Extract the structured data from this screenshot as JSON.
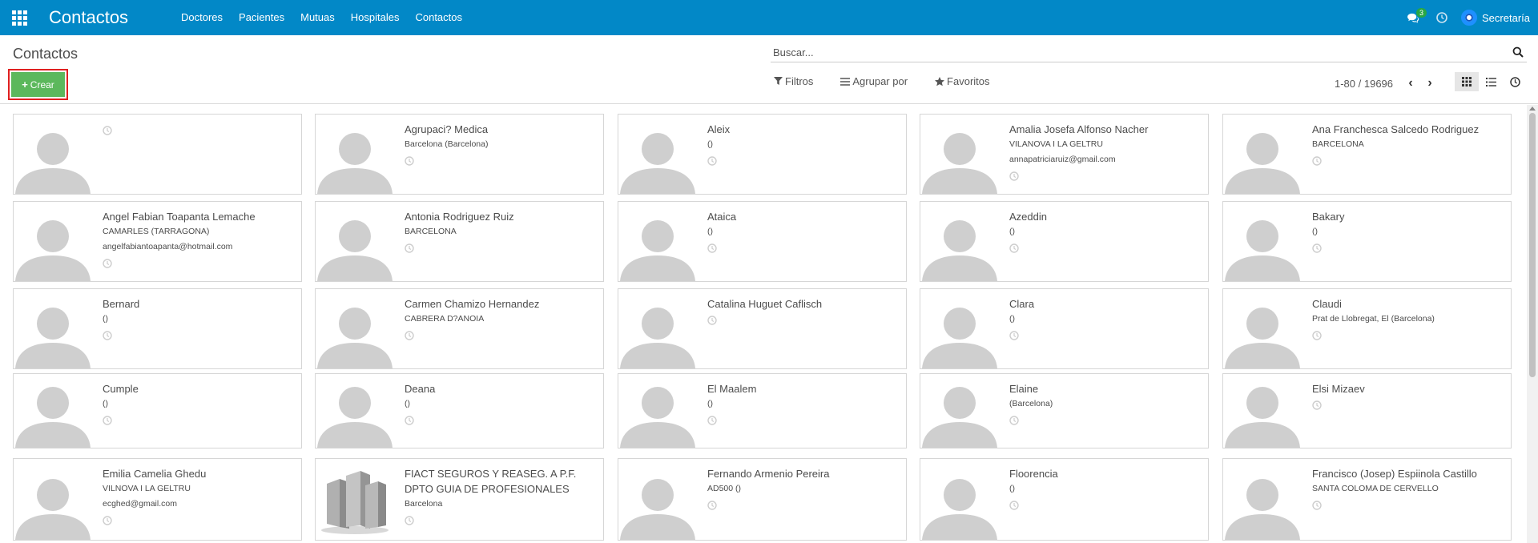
{
  "navbar": {
    "app_title": "Contactos",
    "menu": [
      "Doctores",
      "Pacientes",
      "Mutuas",
      "Hospitales",
      "Contactos"
    ],
    "messages_count": "3",
    "user_name": "Secretaría"
  },
  "control_panel": {
    "title": "Contactos",
    "create_label": "Crear",
    "search_placeholder": "Buscar...",
    "filters_label": "Filtros",
    "group_by_label": "Agrupar por",
    "favorites_label": "Favoritos",
    "pager": "1-80 / 19696"
  },
  "cards": [
    {
      "name": "",
      "lines": [],
      "type": "person"
    },
    {
      "name": "Agrupaci? Medica",
      "lines": [
        "Barcelona (Barcelona)"
      ],
      "type": "person"
    },
    {
      "name": "Aleix",
      "lines": [
        "()"
      ],
      "type": "person"
    },
    {
      "name": "Amalia Josefa Alfonso Nacher",
      "lines": [
        "VILANOVA I LA GELTRU",
        "annapatriciaruiz@gmail.com"
      ],
      "type": "person"
    },
    {
      "name": "Ana Franchesca Salcedo Rodriguez",
      "lines": [
        "BARCELONA"
      ],
      "type": "person"
    },
    {
      "name": "Angel Fabian Toapanta Lemache",
      "lines": [
        "CAMARLES (TARRAGONA)",
        "angelfabiantoapanta@hotmail.com"
      ],
      "type": "person"
    },
    {
      "name": "Antonia Rodriguez Ruiz",
      "lines": [
        "BARCELONA"
      ],
      "type": "person"
    },
    {
      "name": "Ataica",
      "lines": [
        "()"
      ],
      "type": "person"
    },
    {
      "name": "Azeddin",
      "lines": [
        "()"
      ],
      "type": "person"
    },
    {
      "name": "Bakary",
      "lines": [
        "()"
      ],
      "type": "person"
    },
    {
      "name": "Bernard",
      "lines": [
        "()"
      ],
      "type": "person"
    },
    {
      "name": "Carmen Chamizo Hernandez",
      "lines": [
        "CABRERA D?ANOIA"
      ],
      "type": "person"
    },
    {
      "name": "Catalina Huguet Caflisch",
      "lines": [],
      "type": "person"
    },
    {
      "name": "Clara",
      "lines": [
        "()"
      ],
      "type": "person"
    },
    {
      "name": "Claudi",
      "lines": [
        "Prat de Llobregat, El (Barcelona)"
      ],
      "type": "person"
    },
    {
      "name": "Cumple",
      "lines": [
        "()"
      ],
      "type": "person"
    },
    {
      "name": "Deana",
      "lines": [
        "()"
      ],
      "type": "person"
    },
    {
      "name": "El Maalem",
      "lines": [
        "()"
      ],
      "type": "person"
    },
    {
      "name": "Elaine",
      "lines": [
        "(Barcelona)"
      ],
      "type": "person"
    },
    {
      "name": "Elsi Mizaev",
      "lines": [],
      "type": "person"
    },
    {
      "name": "Emilia Camelia Ghedu",
      "lines": [
        "VILNOVA I LA GELTRU",
        "ecghed@gmail.com"
      ],
      "type": "person"
    },
    {
      "name": "FIACT SEGUROS Y REASEG. A P.F. DPTO GUIA DE PROFESIONALES",
      "lines": [
        "Barcelona"
      ],
      "type": "company"
    },
    {
      "name": "Fernando Armenio Pereira",
      "lines": [
        "AD500 ()"
      ],
      "type": "person"
    },
    {
      "name": "Floorencia",
      "lines": [
        "()"
      ],
      "type": "person"
    },
    {
      "name": "Francisco (Josep) Espiinola Castillo",
      "lines": [
        "SANTA COLOMA DE CERVELLO"
      ],
      "type": "person"
    }
  ]
}
